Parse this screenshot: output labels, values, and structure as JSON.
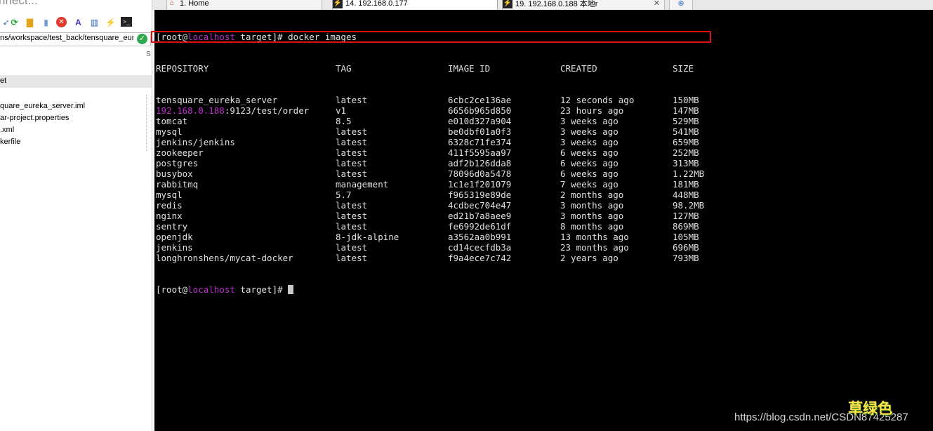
{
  "left_panel": {
    "connect_text": "nnect...",
    "path_text": "ns/workspace/test_back/tensquare_eur",
    "selected_item": "et",
    "files": [
      "quare_eureka_server.iml",
      "ar-project.properties",
      ".xml",
      "kerfile"
    ],
    "scroll_label": "S"
  },
  "tabs": [
    {
      "label": "1. Home"
    },
    {
      "label": "14. 192.168.0.177"
    },
    {
      "label": "19. 192.168.0.188 本地r"
    }
  ],
  "terminal": {
    "prompt_user": "[root@",
    "prompt_host": "localhost",
    "prompt_dir": " target]# ",
    "command": "docker images",
    "headers": [
      "REPOSITORY",
      "TAG",
      "IMAGE ID",
      "CREATED",
      "SIZE"
    ],
    "rows": [
      {
        "repo": "tensquare_eureka_server",
        "tag": "latest",
        "id": "6cbc2ce136ae",
        "created": "12 seconds ago",
        "size": "150MB"
      },
      {
        "repo_host": "192.168.0.188",
        "repo": ":9123/test/order",
        "tag": "v1",
        "id": "6656b965d850",
        "created": "23 hours ago",
        "size": "147MB"
      },
      {
        "repo": "tomcat",
        "tag": "8.5",
        "id": "e010d327a904",
        "created": "3 weeks ago",
        "size": "529MB"
      },
      {
        "repo": "mysql",
        "tag": "latest",
        "id": "be0dbf01a0f3",
        "created": "3 weeks ago",
        "size": "541MB"
      },
      {
        "repo": "jenkins/jenkins",
        "tag": "latest",
        "id": "6328c71fe374",
        "created": "3 weeks ago",
        "size": "659MB"
      },
      {
        "repo": "zookeeper",
        "tag": "latest",
        "id": "411f5595aa97",
        "created": "6 weeks ago",
        "size": "252MB"
      },
      {
        "repo": "postgres",
        "tag": "latest",
        "id": "adf2b126dda8",
        "created": "6 weeks ago",
        "size": "313MB"
      },
      {
        "repo": "busybox",
        "tag": "latest",
        "id": "78096d0a5478",
        "created": "6 weeks ago",
        "size": "1.22MB"
      },
      {
        "repo": "rabbitmq",
        "tag": "management",
        "id": "1c1e1f201079",
        "created": "7 weeks ago",
        "size": "181MB"
      },
      {
        "repo": "mysql",
        "tag": "5.7",
        "id": "f965319e89de",
        "created": "2 months ago",
        "size": "448MB"
      },
      {
        "repo": "redis",
        "tag": "latest",
        "id": "4cdbec704e47",
        "created": "3 months ago",
        "size": "98.2MB"
      },
      {
        "repo": "nginx",
        "tag": "latest",
        "id": "ed21b7a8aee9",
        "created": "3 months ago",
        "size": "127MB"
      },
      {
        "repo": "sentry",
        "tag": "latest",
        "id": "fe6992de61df",
        "created": "8 months ago",
        "size": "869MB"
      },
      {
        "repo": "openjdk",
        "tag": "8-jdk-alpine",
        "id": "a3562aa0b991",
        "created": "13 months ago",
        "size": "105MB"
      },
      {
        "repo": "jenkins",
        "tag": "latest",
        "id": "cd14cecfdb3a",
        "created": "23 months ago",
        "size": "696MB"
      },
      {
        "repo": "longhronshens/mycat-docker",
        "tag": "latest",
        "id": "f9a4ece7c742",
        "created": "2 years ago",
        "size": "793MB"
      }
    ]
  },
  "watermark": {
    "url": "https://blog.csdn.net/CSDN87425287",
    "logo": "草绿色"
  },
  "colors": {
    "terminal_bg": "#000000",
    "terminal_fg": "#e0e0e0",
    "host_magenta": "#c030d0",
    "highlight_red": "#e01010"
  }
}
